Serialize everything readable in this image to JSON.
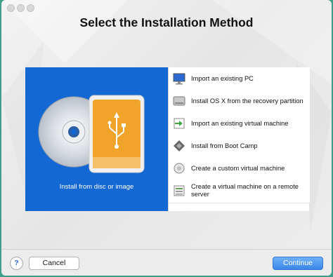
{
  "dialog": {
    "title": "Select the Installation Method"
  },
  "main_option": {
    "label": "Install from disc or image"
  },
  "options": [
    {
      "label": "Import an existing PC",
      "icon": "pc-monitor-icon"
    },
    {
      "label": "Install OS X from the recovery partition",
      "icon": "hard-drive-icon"
    },
    {
      "label": "Import an existing virtual machine",
      "icon": "import-vm-icon"
    },
    {
      "label": "Install from Boot Camp",
      "icon": "boot-camp-icon"
    },
    {
      "label": "Create a custom virtual machine",
      "icon": "custom-vm-icon"
    },
    {
      "label": "Create a virtual machine on a remote server",
      "icon": "remote-server-icon"
    }
  ],
  "footer": {
    "help_label": "?",
    "cancel_label": "Cancel",
    "continue_label": "Continue"
  },
  "colors": {
    "accent": "#1468d3",
    "desktop": "#3f9e89",
    "usb": "#f0a52a"
  }
}
